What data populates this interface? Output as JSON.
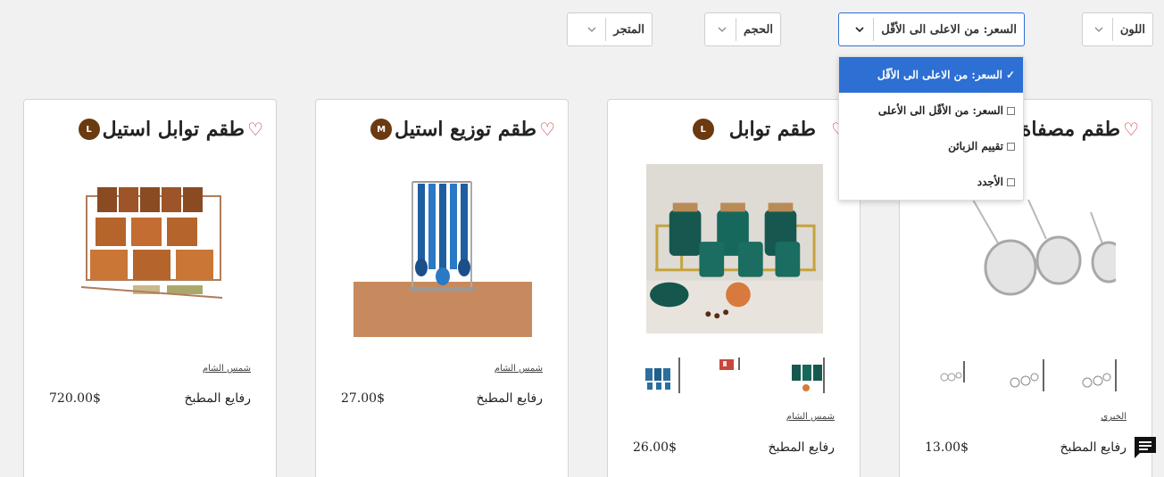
{
  "filters": [
    {
      "id": "color",
      "label": "اللون"
    },
    {
      "id": "price",
      "label": "السعر: من الاعلى الى الأقّل"
    },
    {
      "id": "size",
      "label": "الحجم"
    },
    {
      "id": "store",
      "label": "المتجر"
    }
  ],
  "sort_dropdown": {
    "options": [
      {
        "label": "السعر: من الاعلى الى الأقّل",
        "mark": "✓",
        "selected": true
      },
      {
        "label": "السعر: من الأقّل الى الأعلى",
        "selected": false
      },
      {
        "label": "تقييم الزبائن",
        "selected": false
      },
      {
        "label": "الأجدد",
        "selected": false
      }
    ]
  },
  "products": [
    {
      "title": "طقم توابل استيل",
      "badge": "L",
      "store": "شمس الشام",
      "category": "رفايع المطبخ",
      "price": "720.00$"
    },
    {
      "title": "طقم توزيع استيل",
      "badge": "M",
      "store": "شمس الشام",
      "category": "رفايع المطبخ",
      "price": "27.00$"
    },
    {
      "title": "طقم توابل",
      "badge": "L",
      "store": "شمس الشام",
      "category": "رفايع المطبخ",
      "price": "26.00$"
    },
    {
      "title": "طقم مصفاة",
      "store": "الخيري",
      "category": "رفايع المطبخ",
      "price": "13.00$"
    }
  ],
  "colors": {
    "accent": "#2d6fd3",
    "heart": "#d0303e",
    "badge": "#6b3a10"
  },
  "icons": {
    "heart": "heart-icon",
    "chevron": "chevron-down-icon",
    "chat": "chat-icon",
    "check": "check-icon"
  }
}
